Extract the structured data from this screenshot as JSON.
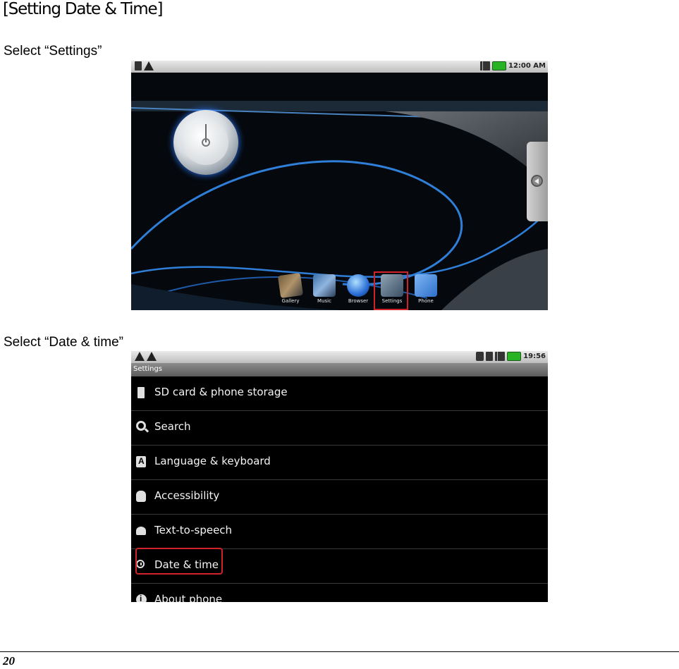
{
  "heading": "[Setting Date & Time]",
  "step1": {
    "caption": "Select “Settings”",
    "status_time": "12:00 AM",
    "dock_apps": [
      "Gallery",
      "Music",
      "Browser",
      "Settings",
      "Phone"
    ],
    "highlighted_app": "Settings"
  },
  "step2": {
    "caption": "Select “Date & time”",
    "status_time": "19:56",
    "title": "Settings",
    "items": [
      {
        "label": "SD card & phone storage",
        "icon": "sd-card-icon"
      },
      {
        "label": "Search",
        "icon": "search-icon"
      },
      {
        "label": "Language & keyboard",
        "icon": "keyboard-icon"
      },
      {
        "label": "Accessibility",
        "icon": "accessibility-hand-icon"
      },
      {
        "label": "Text-to-speech",
        "icon": "speech-icon"
      },
      {
        "label": "Date & time",
        "icon": "clock-icon"
      },
      {
        "label": "About phone",
        "icon": "info-icon"
      }
    ],
    "highlighted_item": "Date & time",
    "highlight_color": "#d0222b"
  },
  "page_number": "20"
}
